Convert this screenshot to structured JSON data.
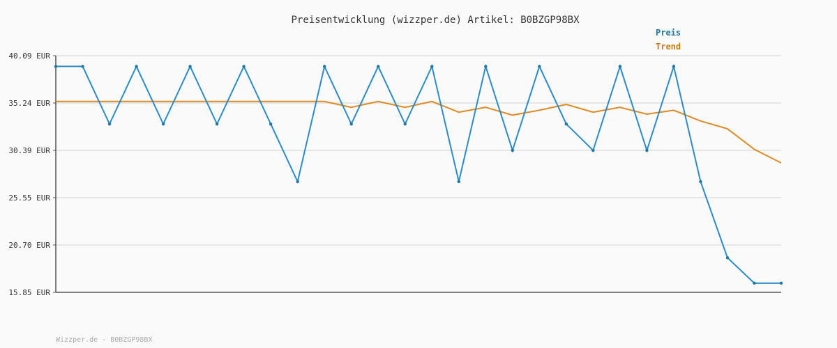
{
  "title": "Preisentwicklung (wizzper.de) Artikel: B0BZGP98BX",
  "footer": "Wizzper.de - B0BZGP98BX",
  "colors": {
    "preis": "#2b8ccc",
    "preis_legend": "#1f77a4",
    "trend": "#e08a24",
    "trend_legend": "#d07a10",
    "grid": "#e6e6e6",
    "axis": "#555555"
  },
  "chart_data": {
    "type": "line",
    "title": "Preisentwicklung (wizzper.de) Artikel: B0BZGP98BX",
    "xlabel": "",
    "ylabel": "",
    "ylim": [
      15.85,
      40.09
    ],
    "yticks": [
      "40.09 EUR",
      "35.24 EUR",
      "30.39 EUR",
      "25.55 EUR",
      "20.70 EUR",
      "15.85 EUR"
    ],
    "ytick_values": [
      40.09,
      35.24,
      30.39,
      25.55,
      20.7,
      15.85
    ],
    "grid": true,
    "legend_position": "top-right",
    "x": [
      0,
      1,
      2,
      3,
      4,
      5,
      6,
      7,
      8,
      9,
      10,
      11,
      12,
      13,
      14,
      15,
      16,
      17,
      18,
      19,
      20,
      21,
      22,
      23,
      24,
      25,
      26,
      27
    ],
    "series": [
      {
        "name": "Preis",
        "values": [
          38.99,
          38.99,
          33.09,
          38.99,
          33.09,
          38.99,
          33.09,
          38.99,
          33.09,
          27.19,
          38.99,
          33.09,
          38.99,
          33.09,
          38.99,
          27.19,
          38.99,
          30.39,
          38.99,
          33.09,
          30.39,
          38.99,
          30.39,
          38.99,
          27.19,
          19.39,
          16.79,
          16.79
        ]
      },
      {
        "name": "Trend",
        "values": [
          35.4,
          35.4,
          35.4,
          35.4,
          35.4,
          35.4,
          35.4,
          35.4,
          35.4,
          35.4,
          35.4,
          34.8,
          35.4,
          34.8,
          35.4,
          34.3,
          34.8,
          34.0,
          34.5,
          35.1,
          34.3,
          34.8,
          34.1,
          34.5,
          33.4,
          32.6,
          30.5,
          29.1
        ]
      }
    ]
  }
}
